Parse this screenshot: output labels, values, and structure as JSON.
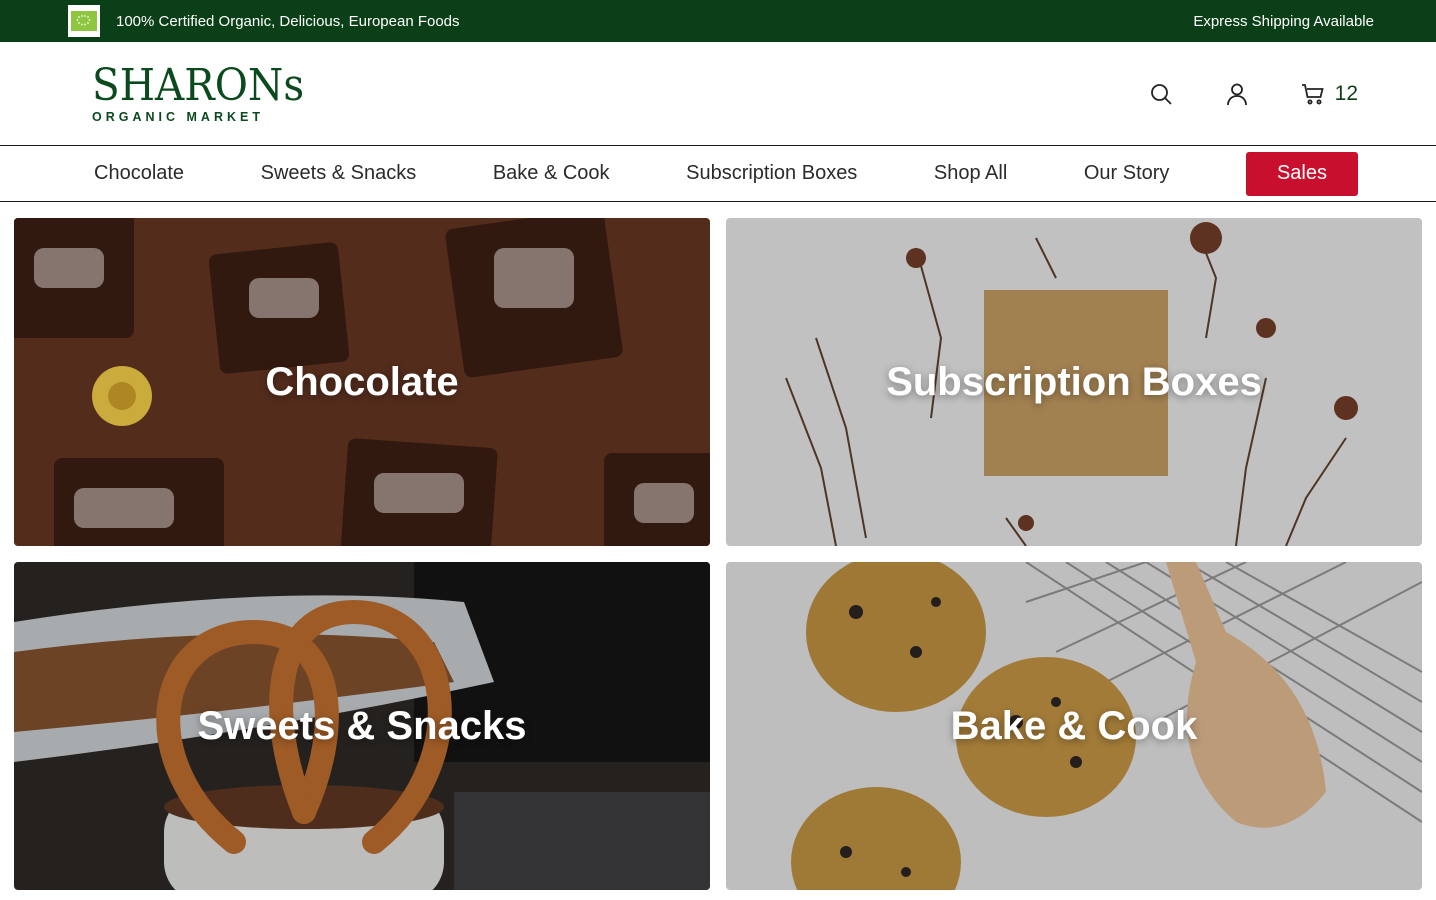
{
  "announcement": {
    "left_text": "100% Certified Organic, Delicious, European Foods",
    "right_text": "Express Shipping Available",
    "badge_icon": "eu-organic-leaf-icon"
  },
  "brand": {
    "name": "SHARONs",
    "tagline": "ORGANIC MARKET",
    "color": "#0b4a1d"
  },
  "header": {
    "icons": [
      "search-icon",
      "user-icon",
      "cart-icon"
    ],
    "cart_count": "12"
  },
  "nav": {
    "items": [
      "Chocolate",
      "Sweets & Snacks",
      "Bake & Cook",
      "Subscription Boxes",
      "Shop All",
      "Our Story"
    ],
    "sales_label": "Sales",
    "sales_color": "#c8102e"
  },
  "categories": [
    {
      "label": "Chocolate"
    },
    {
      "label": "Subscription Boxes"
    },
    {
      "label": "Sweets & Snacks"
    },
    {
      "label": "Bake & Cook"
    }
  ],
  "colors": {
    "topbar": "#0b3f17",
    "accent": "#c8102e"
  }
}
